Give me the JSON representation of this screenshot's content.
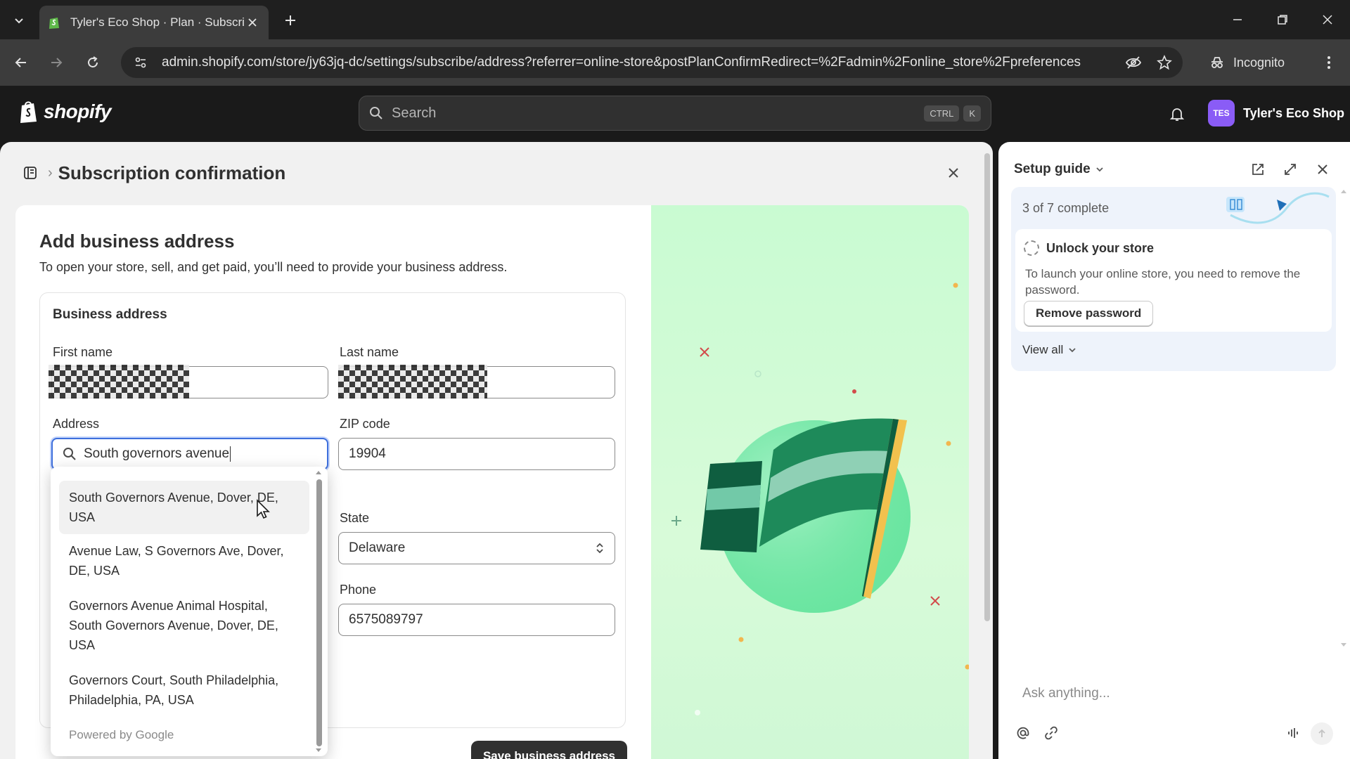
{
  "browser": {
    "tab_title": "Tyler's Eco Shop · Plan · Subscri",
    "url": "admin.shopify.com/store/jy63jq-dc/settings/subscribe/address?referrer=online-store&postPlanConfirmRedirect=%2Fadmin%2Fonline_store%2Fpreferences",
    "incognito_label": "Incognito"
  },
  "topbar": {
    "logo_text": "shopify",
    "search_placeholder": "Search",
    "shortcut_keys": [
      "CTRL",
      "K"
    ],
    "store_initials": "TES",
    "store_name": "Tyler's Eco Shop"
  },
  "modal": {
    "title": "Subscription confirmation",
    "form_title": "Add business address",
    "form_subtitle": "To open your store, sell, and get paid, you’ll need to provide your business address.",
    "section_title": "Business address",
    "fields": {
      "first_name_label": "First name",
      "last_name_label": "Last name",
      "address_label": "Address",
      "address_value": "South governors avenue",
      "zip_label": "ZIP code",
      "zip_value": "19904",
      "state_label": "State",
      "state_value": "Delaware",
      "phone_label": "Phone",
      "phone_value": "6575089797"
    },
    "suggestions": [
      "South Governors Avenue, Dover, DE, USA",
      "Avenue Law, S Governors Ave, Dover, DE, USA",
      "Governors Avenue Animal Hospital, South Governors Avenue, Dover, DE, USA",
      "Governors Court, South Philadelphia, Philadelphia, PA, USA"
    ],
    "powered_by": "Powered by Google",
    "save_button": "Save business address"
  },
  "setup_guide": {
    "title": "Setup guide",
    "progress": "3 of 7 complete",
    "step_title": "Unlock your store",
    "step_description": "To launch your online store, you need to remove the password.",
    "step_button": "Remove password",
    "view_all": "View all",
    "ask_placeholder": "Ask anything..."
  },
  "colors": {
    "accent_focus": "#3e6fdc",
    "illustration_bg": "#c9fbd2",
    "flag_green": "#1e8a5a",
    "avatar": "#8a5cf6"
  }
}
